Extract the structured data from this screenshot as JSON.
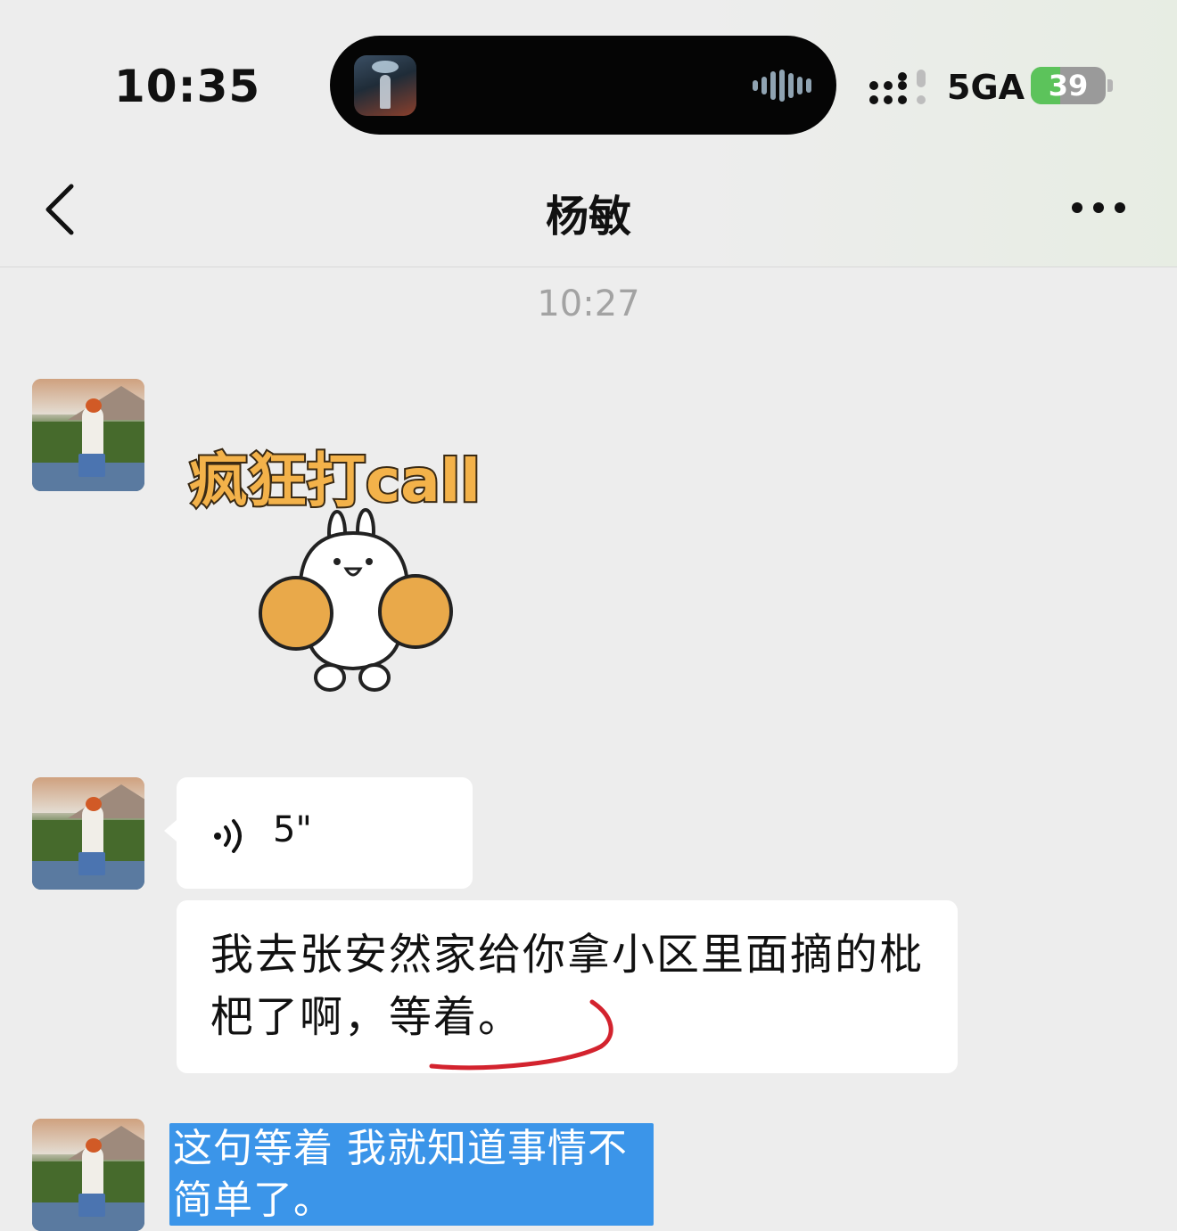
{
  "status_bar": {
    "time": "10:35",
    "network": "5GA",
    "battery_level": "39",
    "battery_percent": 39
  },
  "nav": {
    "title": "杨敏",
    "back_icon": "chevron-left-icon",
    "more_icon": "ellipsis-icon"
  },
  "chat": {
    "timestamp": "10:27",
    "messages": [
      {
        "type": "sticker",
        "sticker_text": "疯狂打call"
      },
      {
        "type": "voice",
        "duration": "5\""
      },
      {
        "type": "text",
        "text": "我去张安然家给你拿小区里面摘的枇杷了啊，等着。"
      }
    ],
    "selected_text": "这句等着 我就知道事情不简单了。"
  },
  "colors": {
    "background": "#ededed",
    "bubble": "#ffffff",
    "selection": "#3b95e9",
    "annotation": "#d3232e",
    "battery_fill": "#5cc35b"
  }
}
